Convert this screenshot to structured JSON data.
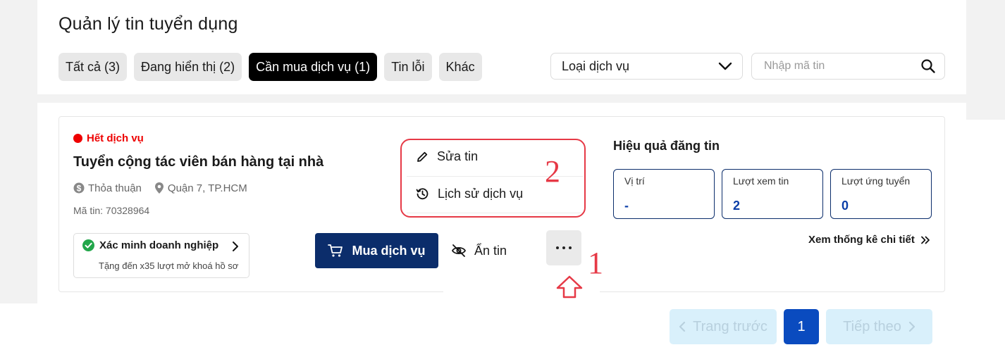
{
  "page_title": "Quản lý tin tuyển dụng",
  "tabs": [
    {
      "label": "Tất cả (3)",
      "active": false
    },
    {
      "label": "Đang hiển thị (2)",
      "active": false
    },
    {
      "label": "Cần mua dịch vụ (1)",
      "active": true
    },
    {
      "label": "Tin lỗi",
      "active": false
    },
    {
      "label": "Khác",
      "active": false
    }
  ],
  "filter": {
    "service_type_label": "Loại dịch vụ"
  },
  "search": {
    "placeholder": "Nhập mã tin",
    "value": ""
  },
  "job": {
    "status": "Hết dịch vụ",
    "title": "Tuyển cộng tác viên bán hàng tại nhà",
    "salary": "Thỏa thuận",
    "location": "Quận 7, TP.HCM",
    "code": "Mã tin: 70328964",
    "verify": {
      "title": "Xác minh doanh nghiệp",
      "subtitle": "Tặng đến x35 lượt mở khoá hồ sơ"
    },
    "actions": {
      "buy_service": "Mua dịch vụ",
      "hide": "Ẩn tin"
    },
    "menu": {
      "edit": "Sửa tin",
      "service_history": "Lịch sử dịch vụ"
    },
    "performance": {
      "title": "Hiệu quả đăng tin",
      "stats": [
        {
          "label": "Vị trí",
          "value": "-"
        },
        {
          "label": "Lượt xem tin",
          "value": "2"
        },
        {
          "label": "Lượt ứng tuyển",
          "value": "0"
        }
      ],
      "detail_link": "Xem thống kê chi tiết"
    }
  },
  "annotations": {
    "step1": "1",
    "step2": "2"
  },
  "pagination": {
    "prev": "Trang trước",
    "current": "1",
    "next": "Tiếp theo"
  },
  "colors": {
    "accent": "#0b2d6b",
    "status_red": "#ee0000",
    "annotation_red": "#e63946",
    "page_current": "#0a4bbf"
  }
}
